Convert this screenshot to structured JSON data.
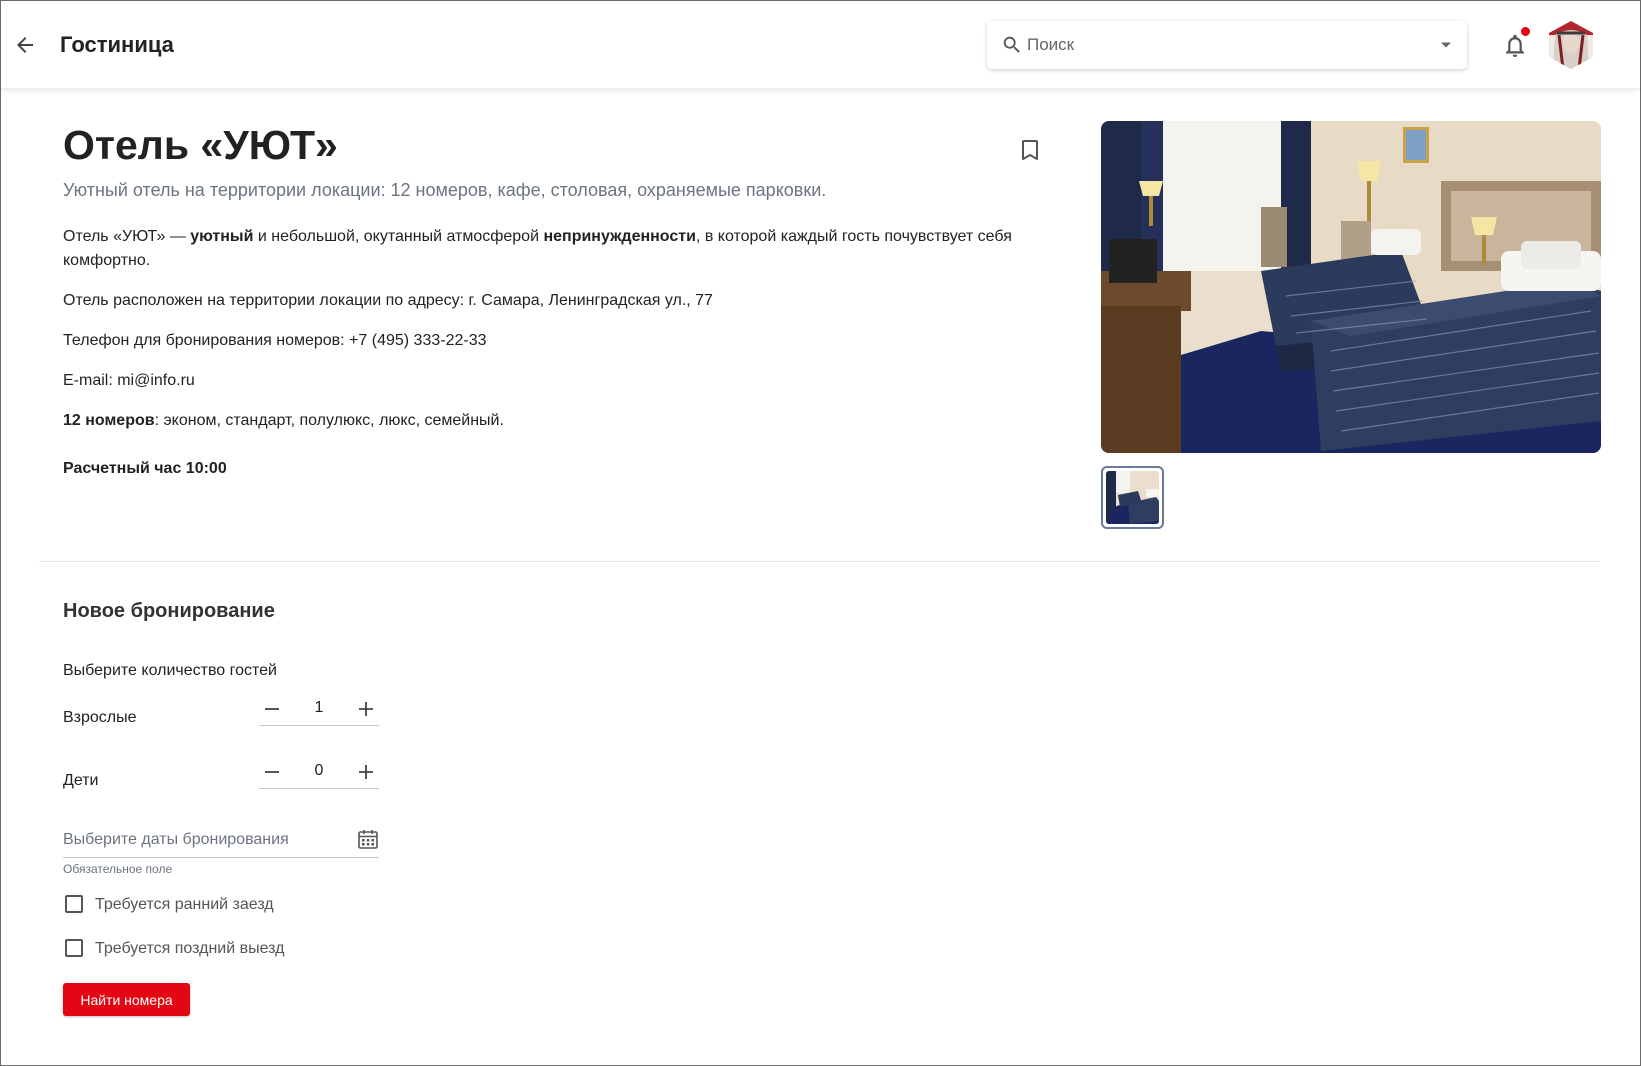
{
  "header": {
    "title": "Гостиница",
    "search_placeholder": "Поиск"
  },
  "hotel": {
    "title": "Отель «УЮТ»",
    "subtitle": "Уютный отель на территории локации: 12 номеров, кафе, столовая, охраняемые парковки.",
    "desc1_a": "Отель «УЮТ» — ",
    "desc1_b": "уютный",
    "desc1_c": " и небольшой, окутанный атмосферой ",
    "desc1_d": "непринужденности",
    "desc1_e": ", в которой каждый гость почувствует себя комфортно.",
    "address": "Отель расположен на территории локации по адресу: г. Самара, Ленинградская ул., 77",
    "phone": "Телефон для бронирования номеров: +7 (495) 333-22-33",
    "email": "E-mail: mi@info.ru",
    "rooms_bold": "12 номеров",
    "rooms_rest": ": эконом, стандарт, полулюкс, люкс, семейный.",
    "checkout": "Расчетный час 10:00"
  },
  "booking": {
    "title": "Новое бронирование",
    "guests_label": "Выберите количество гостей",
    "adults_label": "Взрослые",
    "adults_value": "1",
    "children_label": "Дети",
    "children_value": "0",
    "dates_placeholder": "Выберите даты бронирования",
    "dates_helper": "Обязательное поле",
    "early_checkin": "Требуется ранний заезд",
    "late_checkout": "Требуется поздний выезд",
    "find_button": "Найти номера"
  },
  "colors": {
    "accent": "#e30613",
    "muted_text": "#6b7480"
  },
  "icons": {
    "back": "arrow-left-icon",
    "search": "search-icon",
    "dropdown": "caret-down-icon",
    "notifications": "bell-icon",
    "bookmark": "bookmark-icon",
    "calendar": "calendar-icon",
    "minus": "minus-icon",
    "plus": "plus-icon"
  }
}
